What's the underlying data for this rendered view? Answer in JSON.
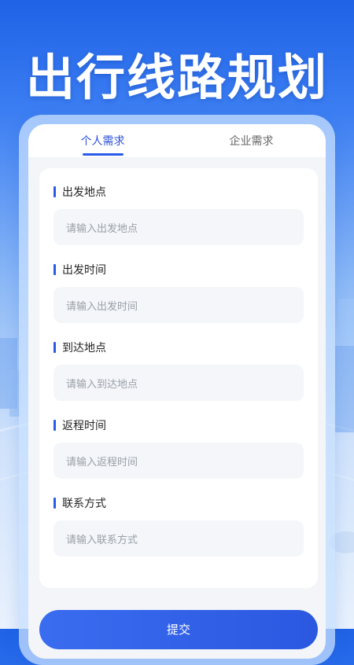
{
  "hero": {
    "title": "出行线路规划"
  },
  "tabs": [
    {
      "label": "个人需求",
      "active": true
    },
    {
      "label": "企业需求",
      "active": false
    }
  ],
  "form": {
    "fields": [
      {
        "label": "出发地点",
        "placeholder": "请输入出发地点"
      },
      {
        "label": "出发时间",
        "placeholder": "请输入出发时间"
      },
      {
        "label": "到达地点",
        "placeholder": "请输入到达地点"
      },
      {
        "label": "返程时间",
        "placeholder": "请输入返程时间"
      },
      {
        "label": "联系方式",
        "placeholder": "请输入联系方式"
      }
    ],
    "submit_label": "提交"
  },
  "colors": {
    "accent": "#2a5ae8",
    "background_top": "#1f62e6"
  }
}
